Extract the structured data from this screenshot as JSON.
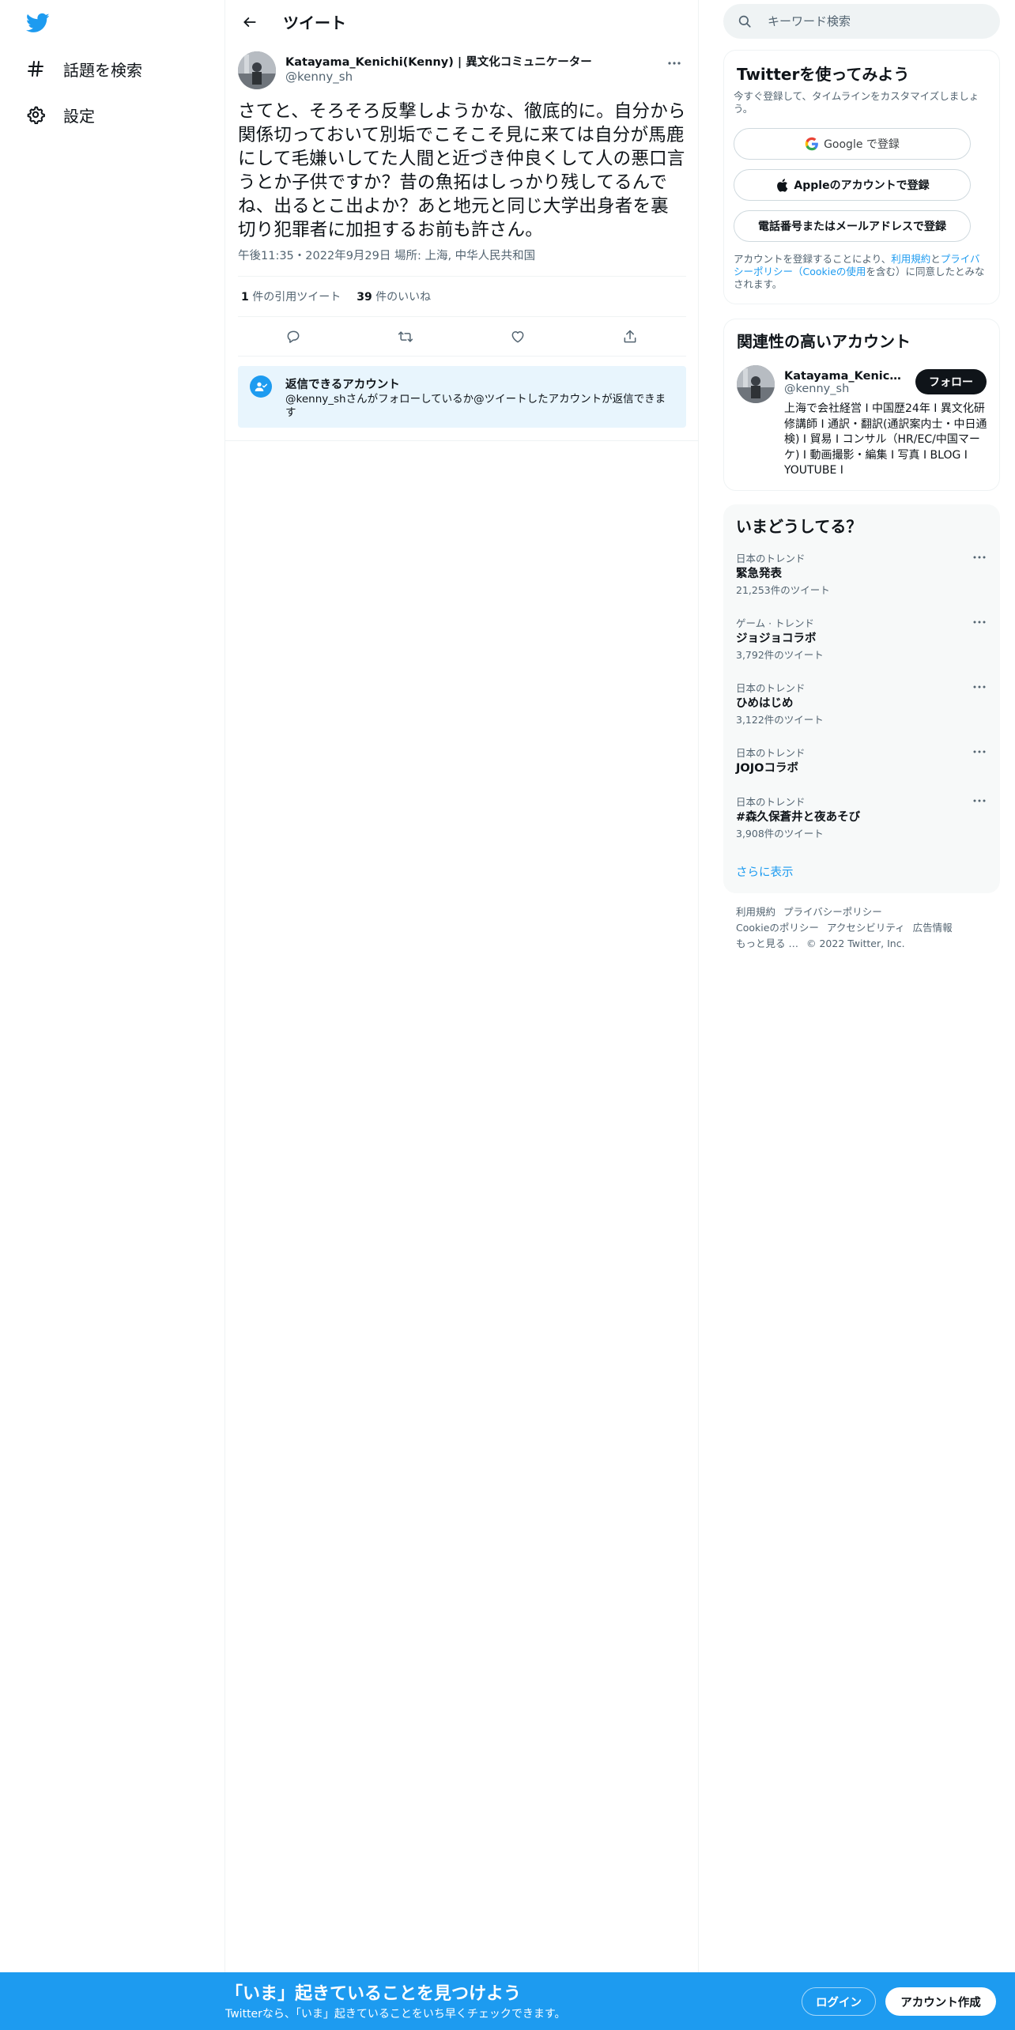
{
  "nav": {
    "logo_icon": "twitter-bird-icon",
    "items": [
      {
        "label": "話題を検索",
        "icon": "hashtag-icon"
      },
      {
        "label": "設定",
        "icon": "gear-icon"
      }
    ]
  },
  "header": {
    "title": "ツイート",
    "back_icon": "arrow-left-icon"
  },
  "tweet": {
    "author_name": "Katayama_Kenichi(Kenny) | 異文化コミュニケーター",
    "author_handle": "@kenny_sh",
    "text": "さてと、そろそろ反撃しようかな、徹底的に。自分から関係切っておいて別垢でこそこそ見に来ては自分が馬鹿にして毛嫌いしてた人間と近づき仲良くして人の悪口言うとか子供ですか？昔の魚拓はしっかり残してるんでね、出るとこ出よか？あと地元と同じ大学出身者を裏切り犯罪者に加担するお前も許さん。",
    "meta": "午後11:35・2022年9月29日 場所: 上海, 中华人民共和国",
    "quote_count": "1",
    "quote_label": "件の引用ツイート",
    "like_count": "39",
    "like_label": "件のいいね",
    "reply_title": "返信できるアカウント",
    "reply_desc": "@kenny_shさんがフォローしているか@ツイートしたアカウントが返信できます"
  },
  "search": {
    "placeholder": "キーワード検索"
  },
  "signup_card": {
    "title": "Twitterを使ってみよう",
    "subtitle": "今すぐ登録して、タイムラインをカスタマイズしましょう。",
    "google_label": "Google で登録",
    "apple_label": "Appleのアカウントで登録",
    "phone_label": "電話番号またはメールアドレスで登録",
    "terms_prefix": "アカウントを登録することにより、",
    "terms_link1": "利用規約",
    "terms_and": "と",
    "terms_link2": "プライバシーポリシー（Cookieの使用",
    "terms_suffix": "を含む）に同意したとみなされます。"
  },
  "related": {
    "title": "関連性の高いアカウント",
    "name": "Katayama_Kenichi(Kenny) | 異文化コミュニケーター",
    "handle": "@kenny_sh",
    "follow_label": "フォロー",
    "bio": "上海で会社経営 I 中国歴24年 I 異文化研修講師 I 通訳・翻訳(通訳案内士・中日通検) I 貿易 I コンサル（HR/EC/中国マーケ) I 動画撮影・編集 I 写真 I BLOG I YOUTUBE I"
  },
  "trends": {
    "title": "いまどうしてる？",
    "items": [
      {
        "category": "日本のトレンド",
        "name": "緊急発表",
        "count": "21,253件のツイート"
      },
      {
        "category": "ゲーム · トレンド",
        "name": "ジョジョコラボ",
        "count": "3,792件のツイート"
      },
      {
        "category": "日本のトレンド",
        "name": "ひめはじめ",
        "count": "3,122件のツイート"
      },
      {
        "category": "日本のトレンド",
        "name": "JOJOコラボ",
        "count": ""
      },
      {
        "category": "日本のトレンド",
        "name": "#森久保蒼井と夜あそび",
        "count": "3,908件のツイート"
      }
    ],
    "show_more": "さらに表示"
  },
  "footer": {
    "terms": "利用規約",
    "privacy": "プライバシーポリシー",
    "cookie": "Cookieのポリシー",
    "accessibility": "アクセシビリティ",
    "ads": "広告情報",
    "more": "もっと見る …",
    "copyright": "© 2022 Twitter, Inc."
  },
  "banner": {
    "title": "「いま」起きていることを見つけよう",
    "subtitle": "Twitterなら、「いま」起きていることをいち早くチェックできます。",
    "login_label": "ログイン",
    "signup_label": "アカウント作成"
  },
  "colors": {
    "accent": "#1d9bf0",
    "text": "#0f1419",
    "secondary": "#536471",
    "border": "#eff3f4"
  }
}
